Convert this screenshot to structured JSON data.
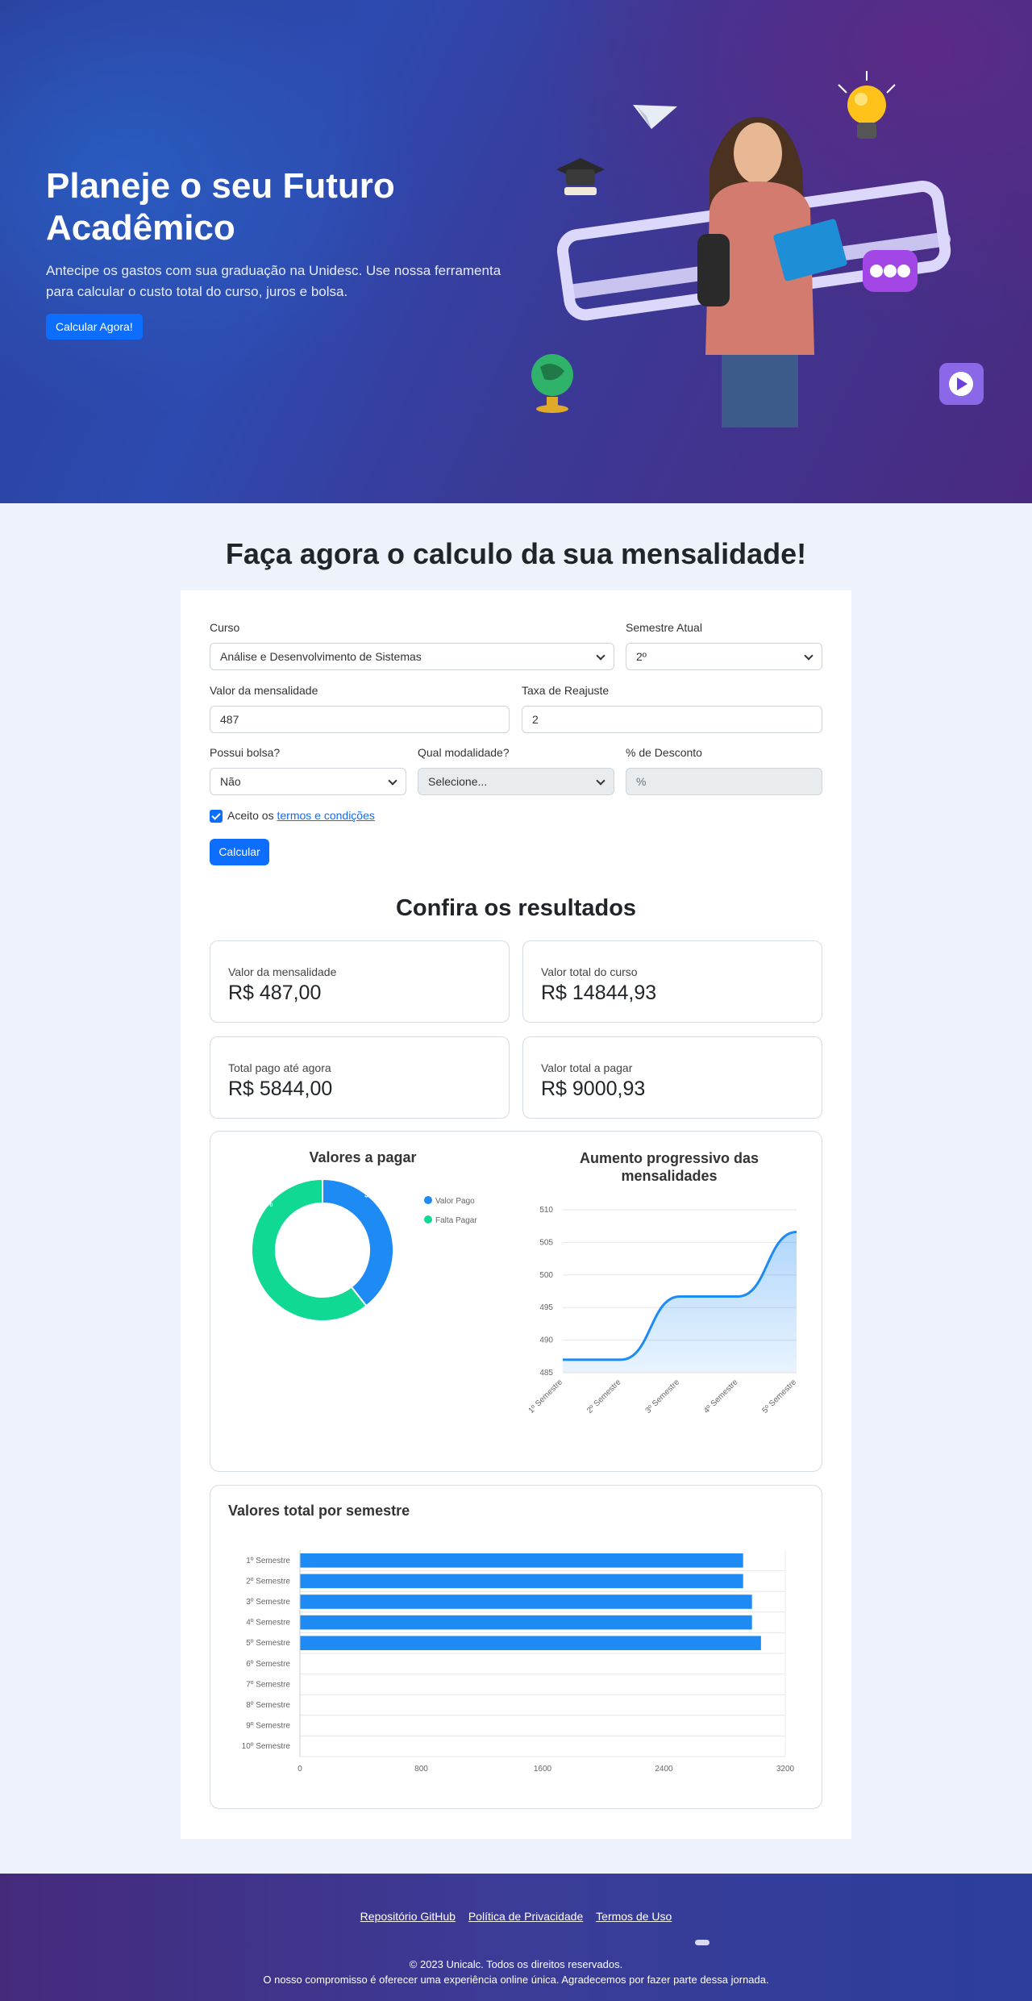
{
  "hero": {
    "title_line1": "Planeje o seu Futuro",
    "title_line2": "Acadêmico",
    "subtitle": "Antecipe os gastos com sua graduação na Unidesc. Use nossa ferramenta para calcular o custo total do curso, juros e bolsa.",
    "cta_label": "Calcular Agora!"
  },
  "form": {
    "title": "Faça agora o calculo da sua mensalidade!",
    "curso_label": "Curso",
    "curso_value": "Análise e Desenvolvimento de Sistemas",
    "semestre_label": "Semestre Atual",
    "semestre_value": "2º",
    "mensalidade_label": "Valor da mensalidade",
    "mensalidade_value": "487",
    "reajuste_label": "Taxa de Reajuste",
    "reajuste_value": "2",
    "bolsa_label": "Possui bolsa?",
    "bolsa_value": "Não",
    "modalidade_label": "Qual modalidade?",
    "modalidade_value": "Selecione...",
    "desconto_label": "% de Desconto",
    "desconto_placeholder": "%",
    "terms_prefix": "Aceito os",
    "terms_link": "termos e condições",
    "submit_label": "Calcular"
  },
  "results": {
    "title": "Confira os resultados",
    "cards": [
      {
        "label": "Valor da mensalidade",
        "value": "R$ 487,00"
      },
      {
        "label": "Valor total do curso",
        "value": "R$ 14844,93"
      },
      {
        "label": "Total pago até agora",
        "value": "R$ 5844,00"
      },
      {
        "label": "Valor total a pagar",
        "value": "R$ 9000,93"
      }
    ]
  },
  "chart_data": [
    {
      "type": "pie",
      "title": "Valores a pagar",
      "labels": [
        "Valor Pago",
        "Falta Pagar"
      ],
      "values": [
        39.4,
        60.6
      ],
      "data_labels": [
        "39.4%",
        "60.6%"
      ],
      "colors": [
        "#1e8bf5",
        "#0fd992"
      ],
      "legend": "right"
    },
    {
      "type": "area",
      "title": "Aumento progressivo das mensalidades",
      "categories": [
        "1º Semestre",
        "2º Semestre",
        "3º Semestre",
        "4º Semestre",
        "5º Semestre"
      ],
      "values": [
        487,
        487,
        496.7,
        496.7,
        506.6
      ],
      "ylim": [
        485,
        510
      ],
      "yticks": [
        485,
        490,
        495,
        500,
        505,
        510
      ],
      "color": "#1e8bf5",
      "grid": true
    },
    {
      "type": "bar",
      "title": "Valores total por semestre",
      "categories": [
        "1º Semestre",
        "2º Semestre",
        "3º Semestre",
        "4º Semestre",
        "5º Semestre",
        "6º Semestre",
        "7º Semestre",
        "8º Semestre",
        "9º Semestre",
        "10º Semestre"
      ],
      "values": [
        2922,
        2922,
        2980.4,
        2980.4,
        3039.8,
        0,
        0,
        0,
        0,
        0
      ],
      "xlim": [
        0,
        3200
      ],
      "xticks": [
        0,
        800,
        1600,
        2400,
        3200
      ],
      "color": "#1e8bf5",
      "orientation": "horizontal",
      "grid": true
    }
  ],
  "footer": {
    "links": [
      "Repositório GitHub",
      "Política de Privacidade",
      "Termos de Uso"
    ],
    "copyright": "© 2023 Unicalc. Todos os direitos reservados.",
    "tagline": "O nosso compromisso é oferecer uma experiência online única. Agradecemos por fazer parte dessa jornada."
  }
}
